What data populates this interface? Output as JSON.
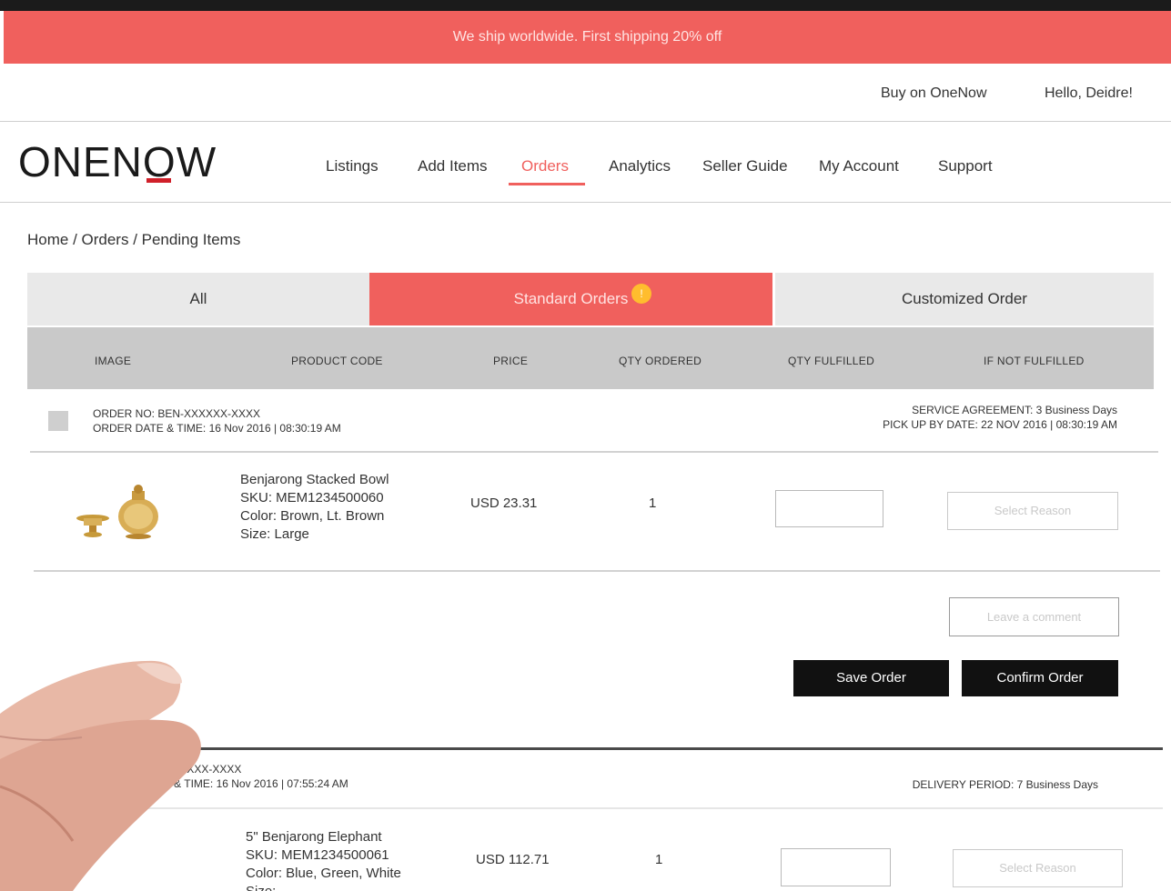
{
  "promo": "We ship worldwide. First shipping 20% off",
  "util": {
    "buy": "Buy on OneNow",
    "hello": "Hello, Deidre!"
  },
  "logo": {
    "pre": "ONEN",
    "o": "O",
    "post": "W"
  },
  "nav": [
    {
      "label": "Listings"
    },
    {
      "label": "Add Items"
    },
    {
      "label": "Orders"
    },
    {
      "label": "Analytics"
    },
    {
      "label": "Seller Guide"
    },
    {
      "label": "My Account"
    },
    {
      "label": "Support"
    }
  ],
  "breadcrumb": "Home / Orders / Pending Items",
  "tabs": [
    {
      "label": "All"
    },
    {
      "label": "Standard Orders",
      "badge": "!"
    },
    {
      "label": "Customized Order"
    }
  ],
  "columns": [
    "IMAGE",
    "PRODUCT CODE",
    "PRICE",
    "QTY ORDERED",
    "QTY FULFILLED",
    "IF NOT FULFILLED"
  ],
  "orders": [
    {
      "order_no": "ORDER NO:   BEN-XXXXXX-XXXX",
      "order_dt": "ORDER DATE & TIME:   16 Nov 2016 | 08:30:19 AM",
      "service": "SERVICE AGREEMENT:  3 Business Days",
      "pickup": "PICK UP BY DATE:   22 NOV 2016 | 08:30:19 AM",
      "item": {
        "name": "Benjarong Stacked Bowl",
        "sku": "SKU: MEM1234500060",
        "color": "Color: Brown, Lt. Brown",
        "size": "Size: Large",
        "price": "USD 23.31",
        "qty": "1",
        "reason_placeholder": "Select Reason"
      },
      "comment_placeholder": "Leave a comment",
      "save": "Save Order",
      "confirm": "Confirm Order"
    },
    {
      "order_no": "ORDER NO:   XXXXXX-XXXX",
      "order_dt": "ORDER DATE & TIME:   16 Nov 2016 | 07:55:24 AM",
      "delivery": "DELIVERY PERIOD:   7 Business Days",
      "item": {
        "name": "5\" Benjarong Elephant",
        "sku": "SKU: MEM1234500061",
        "color": "Color: Blue, Green, White",
        "size": "Size:",
        "price": "USD 112.71",
        "qty": "1",
        "reason_placeholder": "Select Reason"
      }
    }
  ],
  "colors": {
    "accent": "#f0605d",
    "header_gray": "#c9c9c9",
    "tab_gray": "#e9e9e9",
    "button": "#111111"
  }
}
